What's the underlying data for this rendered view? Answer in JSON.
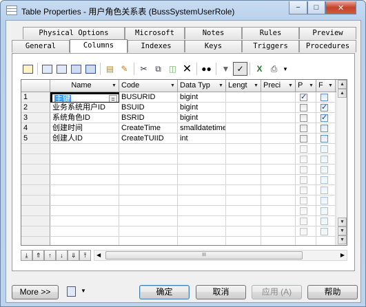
{
  "window": {
    "title": "Table Properties - 用户角色关系表 (BussSystemUserRole)",
    "minimize_glyph": "−",
    "maximize_glyph": "□",
    "close_glyph": "✕"
  },
  "tabs_row1": [
    "Physical Options",
    "Microsoft",
    "Notes",
    "Rules",
    "Preview"
  ],
  "tabs_row2": [
    "General",
    "Columns",
    "Indexes",
    "Keys",
    "Triggers",
    "Procedures"
  ],
  "active_tab": "Columns",
  "grid": {
    "headers": [
      "Name",
      "Code",
      "Data Typ",
      "Lengt",
      "Preci",
      "P",
      "F"
    ],
    "rows": [
      {
        "n": "1",
        "name": "主键",
        "code": "BUSURID",
        "type": "bigint",
        "len": "",
        "prec": "",
        "p": true,
        "f": false,
        "eq": "="
      },
      {
        "n": "2",
        "name": "业务系统用户ID",
        "code": "BSUID",
        "type": "bigint",
        "len": "",
        "prec": "",
        "p": false,
        "f": true
      },
      {
        "n": "3",
        "name": "系统角色ID",
        "code": "BSRID",
        "type": "bigint",
        "len": "",
        "prec": "",
        "p": false,
        "f": true
      },
      {
        "n": "4",
        "name": "创建时间",
        "code": "CreateTime",
        "type": "smalldatetime",
        "len": "",
        "prec": "",
        "p": false,
        "f": false
      },
      {
        "n": "5",
        "name": "创建人ID",
        "code": "CreateTUIID",
        "type": "int",
        "len": "",
        "prec": "",
        "p": false,
        "f": false
      }
    ],
    "empty_rows": 10,
    "hscroll_grip": "III"
  },
  "footer": {
    "more": "More >>",
    "ok": "确定",
    "cancel": "取消",
    "apply": "应用 (A)",
    "help": "帮助"
  },
  "colors": {
    "accent": "#3c7fb1",
    "selection": "#3399ff"
  }
}
